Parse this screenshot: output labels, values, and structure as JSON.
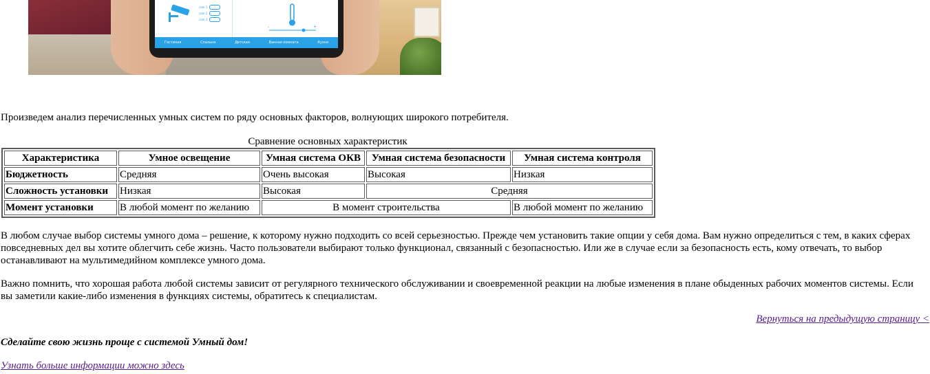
{
  "intro_text": "Произведем анализ перечисленных умных систем по ряду основных факторов, волнующих широкого потребителя.",
  "table": {
    "caption": "Сравнение основных характеристик",
    "headers": [
      "Характеристика",
      "Умное освещение",
      "Умная система ОКВ",
      "Умная система безопасности",
      "Умная система контроля"
    ],
    "rows": [
      {
        "label": "Бюджетность",
        "cells": [
          "Средняя",
          "Очень высокая",
          "Высокая",
          "Низкая"
        ]
      },
      {
        "label": "Сложность установки",
        "cells": [
          "Низкая",
          "Высокая",
          "Средняя"
        ]
      },
      {
        "label": "Момент установки",
        "cells": [
          "В любой момент по желанию",
          "В момент строительства",
          "В любой момент по желанию"
        ]
      }
    ]
  },
  "paragraph1": "В любом случае выбор системы умного дома – решение, к которому нужно подходить со всей серьезностью. Прежде чем установить такие опции у себя дома. Вам нужно определиться с тем, в каких сферах повседневных дел вы хотите облегчить себе жизнь. Часто пользователи выбирают только функционал, связанный с безопасностью. Или же в случае если за безопасность есть, кому отвечать, то выбор останавливают на мультимедийном комплексе умного дома.",
  "paragraph2": "Важно помнить, что хорошая работа любой системы зависит от регулярного технического обслуживании и своевременной реакции на любые изменения в плане обыденных рабочих моментов системы. Если вы заметили какие-либо изменения в функциях системы, обратитесь к специалистам.",
  "back_link": "Вернуться на предыдущую страницу <",
  "slogan": "Сделайте свою жизнь проще с системой Умный дом!",
  "more_link": "Узнать больше информации можно здесь",
  "hero_image": {
    "tablet_tabs": [
      "Гостиная",
      "Спальня",
      "Детская",
      "Ванная комната",
      "Кухня"
    ],
    "camera_rows": [
      "cam 1",
      "cam 2",
      "cam 3"
    ],
    "accent_color": "#2aa2e8"
  }
}
